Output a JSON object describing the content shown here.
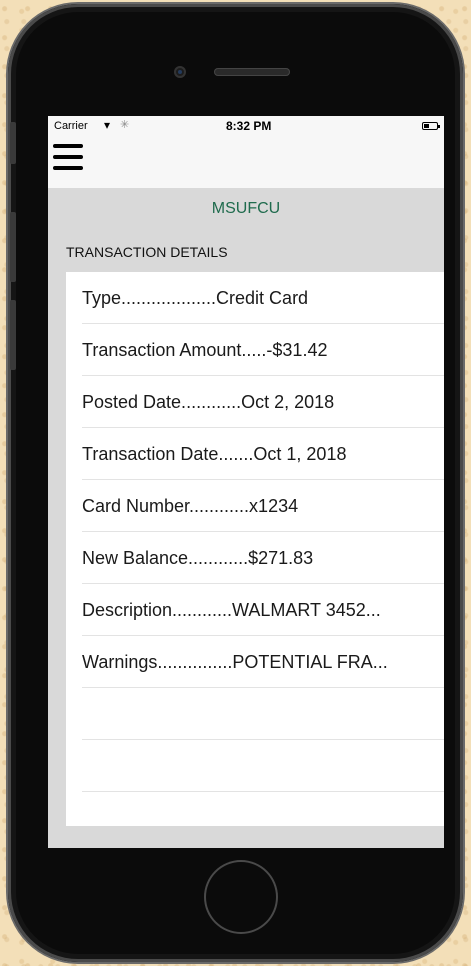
{
  "status_bar": {
    "carrier": "Carrier",
    "wifi_icon": "wifi-icon",
    "time": "8:32 PM",
    "battery_icon": "battery-icon"
  },
  "nav": {
    "menu_icon": "hamburger-menu-icon"
  },
  "brand": {
    "title": "MSUFCU"
  },
  "section": {
    "title": "TRANSACTION DETAILS"
  },
  "rows": [
    {
      "text": "Type...................Credit Card"
    },
    {
      "text": "Transaction Amount.....-$31.42"
    },
    {
      "text": "Posted Date............Oct 2, 2018"
    },
    {
      "text": "Transaction Date.......Oct 1, 2018"
    },
    {
      "text": "Card Number............x1234"
    },
    {
      "text": "New Balance............$271.83"
    },
    {
      "text": "Description............WALMART 3452..."
    },
    {
      "text": "Warnings...............POTENTIAL FRA..."
    },
    {
      "text": ""
    },
    {
      "text": ""
    }
  ],
  "colors": {
    "brand": "#1f6b4d",
    "screen_bg": "#d9d9d9",
    "card_bg": "#ffffff"
  }
}
